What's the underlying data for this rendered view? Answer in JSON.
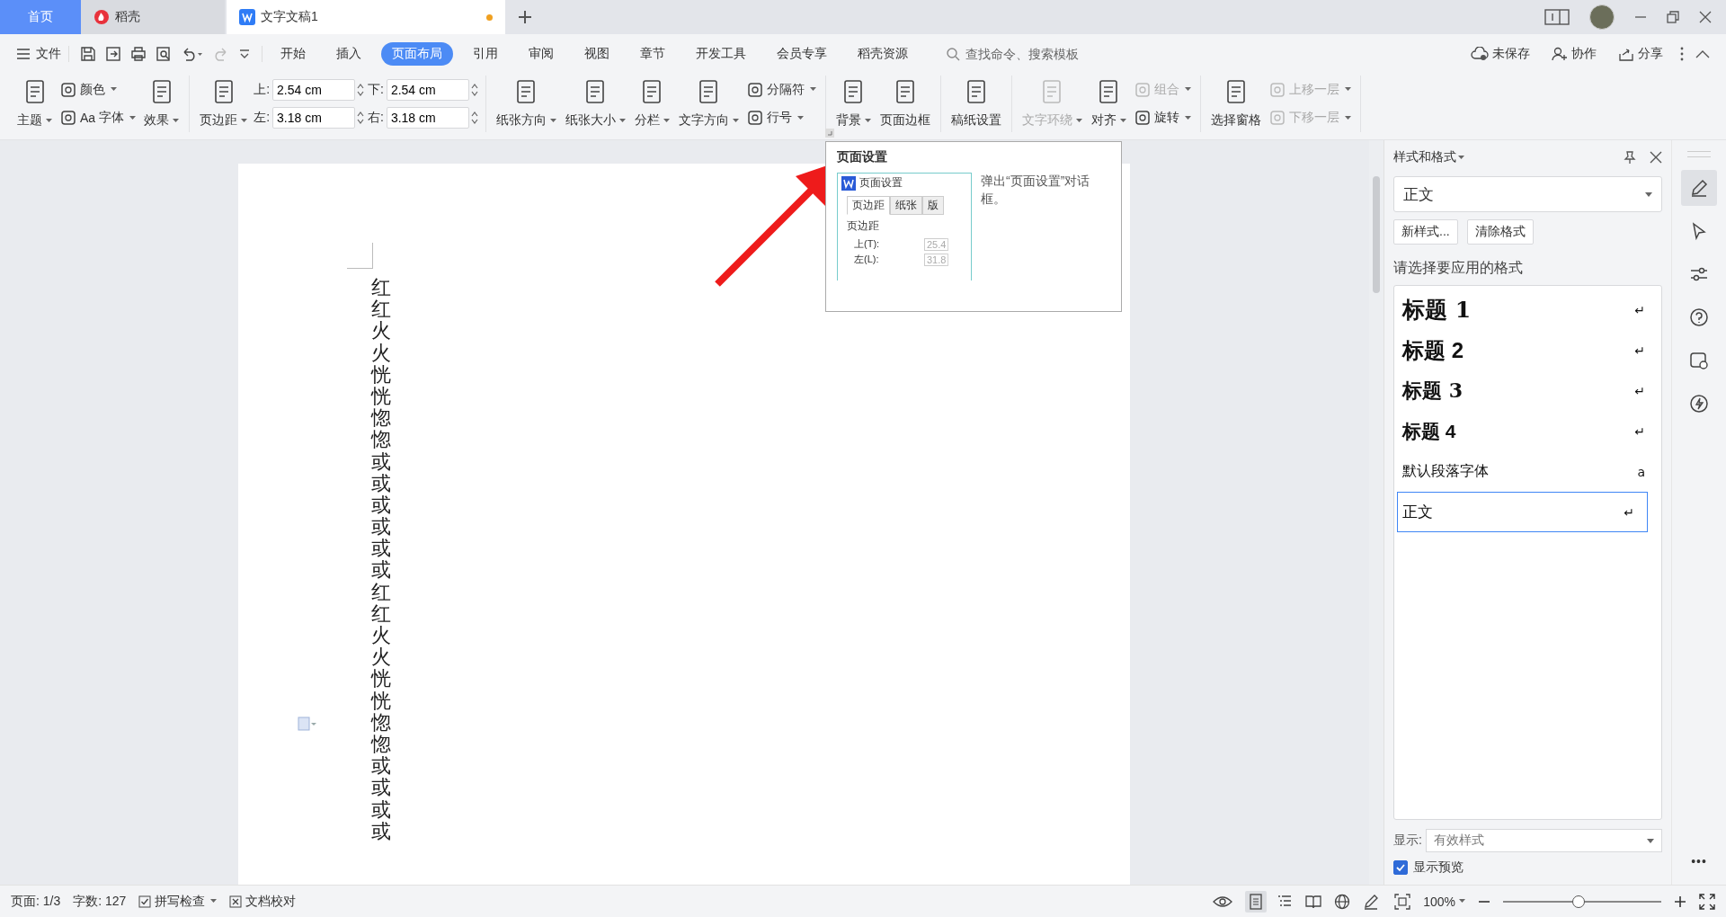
{
  "tabs": [
    {
      "label": "首页",
      "kind": "home",
      "selected": false
    },
    {
      "label": "稻壳",
      "kind": "store",
      "selected": false
    },
    {
      "label": "文字文稿1",
      "kind": "doc",
      "selected": true,
      "modified": true
    }
  ],
  "menu": {
    "file": "文件",
    "ribbon_tabs": [
      {
        "label": "开始",
        "selected": false
      },
      {
        "label": "插入",
        "selected": false
      },
      {
        "label": "页面布局",
        "selected": true
      },
      {
        "label": "引用",
        "selected": false
      },
      {
        "label": "审阅",
        "selected": false
      },
      {
        "label": "视图",
        "selected": false
      },
      {
        "label": "章节",
        "selected": false
      },
      {
        "label": "开发工具",
        "selected": false
      },
      {
        "label": "会员专享",
        "selected": false
      },
      {
        "label": "稻壳资源",
        "selected": false
      }
    ],
    "search": {
      "placeholder": "查找命令、搜索模板"
    },
    "actions": [
      {
        "label": "未保存",
        "kind": "cloud"
      },
      {
        "label": "协作",
        "kind": "user"
      },
      {
        "label": "分享",
        "kind": "share"
      }
    ]
  },
  "ribbon": [
    {
      "items": [
        {
          "kind": "large",
          "label": "主题",
          "caret": true,
          "disabled": false
        },
        {
          "kind": "stack",
          "children": [
            {
              "label": "颜色",
              "caret": true,
              "disabled": false
            },
            {
              "label": "字体",
              "prefix": "Aa",
              "caret": true,
              "disabled": false
            }
          ]
        },
        {
          "kind": "large",
          "label": "效果",
          "caret": true,
          "disabled": false
        }
      ]
    },
    {
      "items": [
        {
          "kind": "large",
          "label": "页边距",
          "caret": true,
          "disabled": false
        },
        {
          "kind": "spins",
          "children": [
            {
              "label": "上:",
              "value": "2.54 cm"
            },
            {
              "label": "左:",
              "value": "3.18 cm"
            }
          ]
        },
        {
          "kind": "spins",
          "children": [
            {
              "label": "下:",
              "value": "2.54 cm"
            },
            {
              "label": "右:",
              "value": "3.18 cm"
            }
          ]
        }
      ]
    },
    {
      "items": [
        {
          "kind": "large",
          "label": "纸张方向",
          "caret": true,
          "disabled": false
        },
        {
          "kind": "large",
          "label": "纸张大小",
          "caret": true,
          "disabled": false
        },
        {
          "kind": "large",
          "label": "分栏",
          "caret": true,
          "disabled": false
        },
        {
          "kind": "large",
          "label": "文字方向",
          "caret": true,
          "disabled": false
        },
        {
          "kind": "stack",
          "children": [
            {
              "label": "分隔符",
              "caret": true,
              "disabled": false
            },
            {
              "label": "行号",
              "caret": true,
              "disabled": false
            }
          ]
        }
      ]
    },
    {
      "items": [
        {
          "kind": "large",
          "label": "背景",
          "caret": true,
          "disabled": false
        },
        {
          "kind": "large",
          "label": "页面边框",
          "caret": false,
          "disabled": false
        }
      ]
    },
    {
      "items": [
        {
          "kind": "large",
          "label": "稿纸设置",
          "caret": false,
          "disabled": false
        }
      ]
    },
    {
      "items": [
        {
          "kind": "large",
          "label": "文字环绕",
          "caret": true,
          "disabled": true
        },
        {
          "kind": "large",
          "label": "对齐",
          "caret": true,
          "disabled": false
        },
        {
          "kind": "stack",
          "children": [
            {
              "label": "组合",
              "caret": true,
              "disabled": true
            },
            {
              "label": "旋转",
              "caret": true,
              "disabled": false
            }
          ]
        }
      ]
    },
    {
      "items": [
        {
          "kind": "large",
          "label": "选择窗格",
          "caret": false,
          "disabled": false
        },
        {
          "kind": "stack",
          "children": [
            {
              "label": "上移一层",
              "caret": true,
              "disabled": true
            },
            {
              "label": "下移一层",
              "caret": true,
              "disabled": true
            }
          ]
        }
      ]
    }
  ],
  "document": {
    "vertical_text": "红红火火恍恍惚惚或或或或或或红红火火恍恍惚惚或或或或"
  },
  "tooltip": {
    "title": "页面设置",
    "description": "弹出“页面设置”对话框。",
    "preview": {
      "title": "页面设置",
      "tabs": [
        {
          "label": "页边距",
          "selected": true
        },
        {
          "label": "纸张",
          "selected": false
        },
        {
          "label": "版",
          "selected": false
        }
      ],
      "group": "页边距",
      "fields": [
        {
          "label": "上(T):",
          "value": "25.4"
        },
        {
          "label": "左(L):",
          "value": "31.8"
        }
      ]
    }
  },
  "styles_panel": {
    "title": "样式和格式",
    "current": "正文",
    "buttons": [
      "新样式...",
      "清除格式"
    ],
    "prompt": "请选择要应用的格式",
    "styles": [
      {
        "label": "标题 1",
        "kind": "h1",
        "mark": "↵",
        "selected": false
      },
      {
        "label": "标题 2",
        "kind": "h2",
        "mark": "↵",
        "selected": false
      },
      {
        "label": "标题 3",
        "kind": "h3",
        "mark": "↵",
        "selected": false
      },
      {
        "label": "标题 4",
        "kind": "h4",
        "mark": "↵",
        "selected": false
      },
      {
        "label": "默认段落字体",
        "kind": "char",
        "mark": "a",
        "selected": false
      },
      {
        "label": "正文",
        "kind": "body",
        "mark": "↵",
        "selected": true
      }
    ],
    "show_label": "显示:",
    "show_value": "有效样式",
    "preview_label": "显示预览",
    "preview_checked": true
  },
  "side_tools": [
    {
      "kind": "pen",
      "selected": true
    },
    {
      "kind": "cursor",
      "selected": false
    },
    {
      "kind": "sliders",
      "selected": false
    },
    {
      "kind": "help",
      "selected": false
    },
    {
      "kind": "image",
      "selected": false
    },
    {
      "kind": "bolt",
      "selected": false
    }
  ],
  "side_more": "•••",
  "status_bar": {
    "page": "页面: 1/3",
    "words": "字数: 127",
    "spell": "拼写检查",
    "proof": "文档校对",
    "zoom": "100%",
    "zoom_slider": {
      "level": 0.48
    },
    "views": [
      {
        "kind": "page",
        "selected": true
      },
      {
        "kind": "outline",
        "selected": false
      },
      {
        "kind": "read",
        "selected": false
      },
      {
        "kind": "web",
        "selected": false
      },
      {
        "kind": "write",
        "selected": false
      }
    ]
  }
}
